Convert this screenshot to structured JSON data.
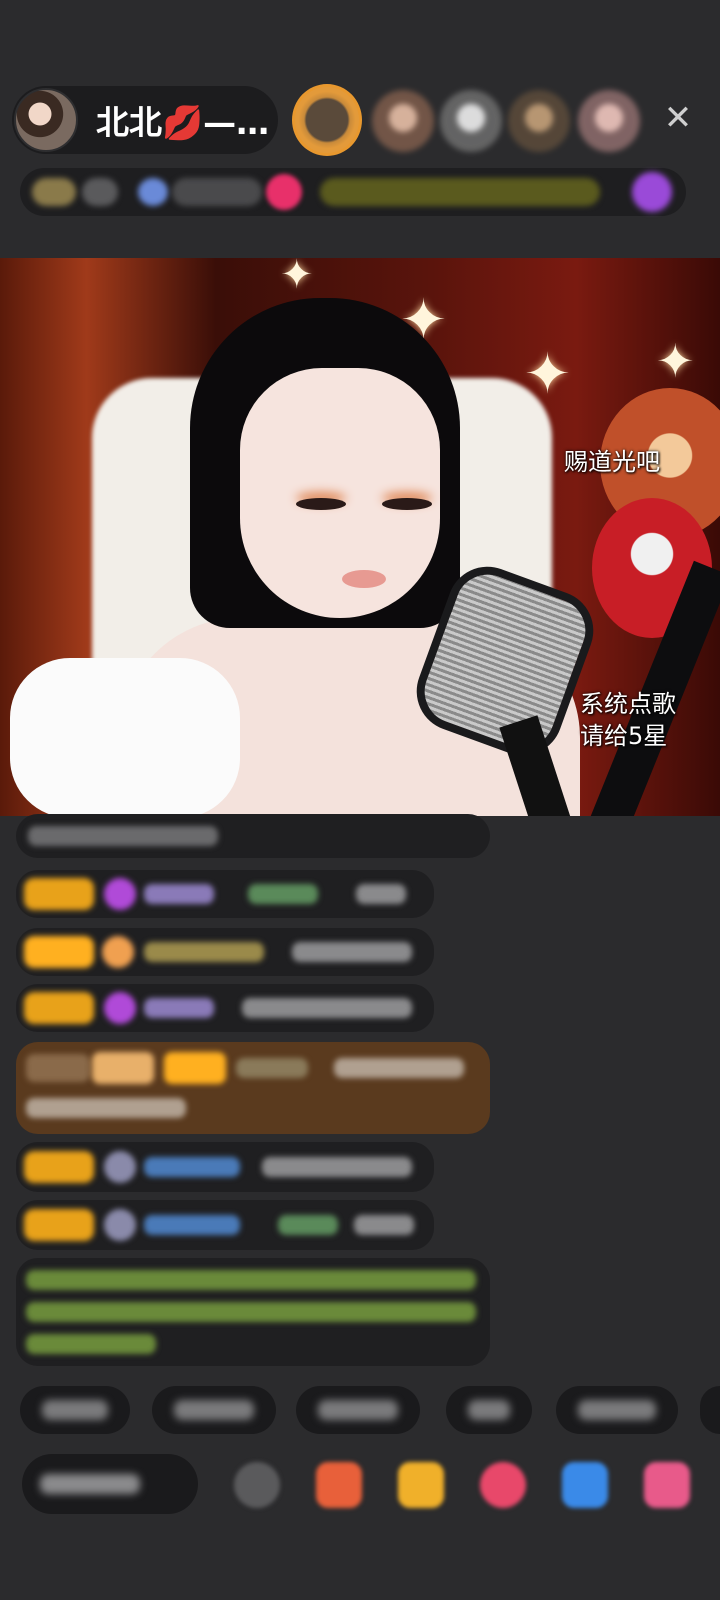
{
  "host": {
    "name": "北北💋—…"
  },
  "video": {
    "overlay_top": "赐道光吧",
    "overlay_bottom_line1": "系统点歌",
    "overlay_bottom_line2": "请给5星"
  },
  "colors": {
    "background": "#2b2b2d",
    "pill": "#1c1c1e",
    "level_badge": "#e8a21a",
    "vip_badge": "#ffb020",
    "highlight_message": "#5a3a1e"
  },
  "icons": {
    "close": "close-icon",
    "gift": "gift-icon",
    "emoji": "emoji-icon"
  }
}
